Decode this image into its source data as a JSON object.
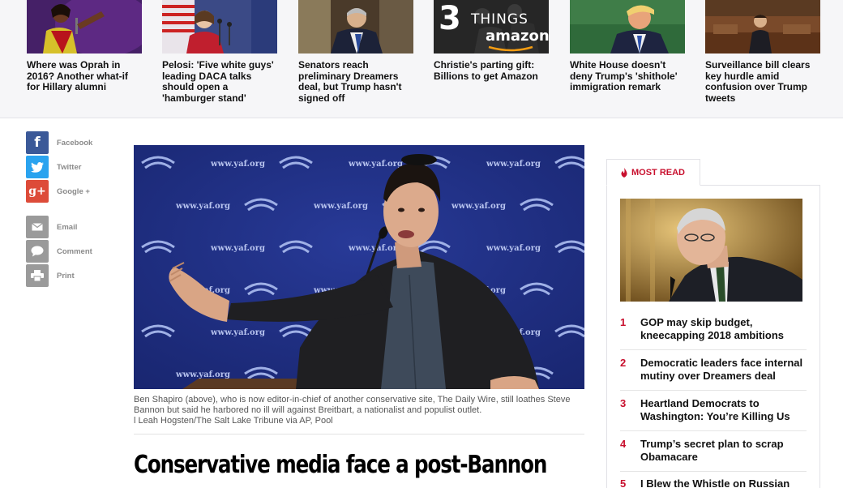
{
  "top_stories": [
    {
      "headline": "Where was Oprah in 2016? Another what-if for Hillary alumni"
    },
    {
      "headline": "Pelosi: 'Five white guys' leading DACA talks should open a 'hamburger stand'"
    },
    {
      "headline": "Senators reach preliminary Dreamers deal, but Trump hasn't signed off"
    },
    {
      "headline": "Christie's parting gift: Billions to get Amazon",
      "thumb_text_big": "3",
      "thumb_text_things": "THINGS",
      "thumb_text_amazon": "amazon"
    },
    {
      "headline": "White House doesn't deny Trump's 'shithole' immigration remark"
    },
    {
      "headline": "Surveillance bill clears key hurdle amid confusion over Trump tweets"
    }
  ],
  "social": [
    {
      "label": "Facebook",
      "glyph": "f",
      "icon": "facebook-icon",
      "color": "#3b5998"
    },
    {
      "label": "Twitter",
      "glyph": "t",
      "icon": "twitter-icon",
      "color": "#2aa3ef"
    },
    {
      "label": "Google +",
      "glyph": "g+",
      "icon": "google-plus-icon",
      "color": "#dd4b39"
    },
    {
      "label": "Email",
      "glyph": "✉",
      "icon": "email-icon",
      "color": "#9a9a9a"
    },
    {
      "label": "Comment",
      "glyph": "💬",
      "icon": "comment-icon",
      "color": "#9a9a9a"
    },
    {
      "label": "Print",
      "glyph": "🖶",
      "icon": "print-icon",
      "color": "#9a9a9a"
    }
  ],
  "hero": {
    "backdrop_text": "www.yaf.org",
    "caption": "Ben Shapiro (above), who is now editor-in-chief of another conservative site, The Daily Wire, still loathes Steve Bannon but said he harbored no ill will against Breitbart, a nationalist and populist outlet.",
    "credit": "l Leah Hogsten/The Salt Lake Tribune via AP, Pool"
  },
  "article": {
    "title": "Conservative media face a post-Bannon"
  },
  "most_read": {
    "tab_label": "MOST READ",
    "accent": "#c8102e",
    "items": [
      {
        "num": "1",
        "title": "GOP may skip budget, kneecapping 2018 ambitions"
      },
      {
        "num": "2",
        "title": "Democratic leaders face internal mutiny over Dreamers deal"
      },
      {
        "num": "3",
        "title": "Heartland Democrats to Washington: You’re Killing Us"
      },
      {
        "num": "4",
        "title": "Trump’s secret plan to scrap Obamacare"
      },
      {
        "num": "5",
        "title": "I Blew the Whistle on Russian"
      }
    ]
  }
}
